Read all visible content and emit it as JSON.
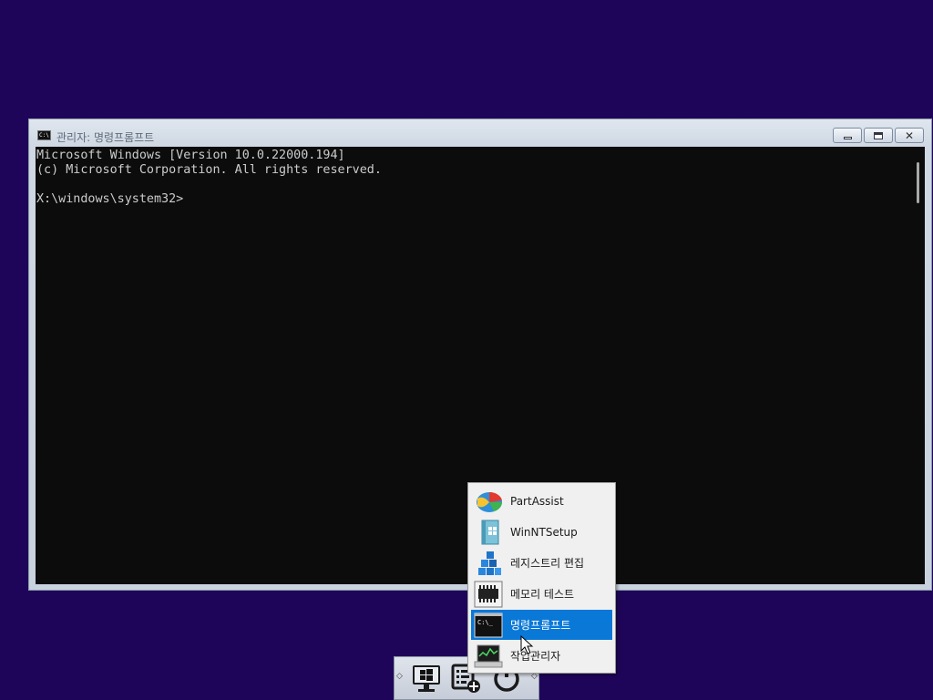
{
  "window": {
    "title": "관리자: 명령프롬프트",
    "icon_text": "C:\\"
  },
  "console": {
    "lines": [
      "Microsoft Windows [Version 10.0.22000.194]",
      "(c) Microsoft Corporation. All rights reserved.",
      "",
      "X:\\windows\\system32>"
    ]
  },
  "menu": {
    "items": [
      {
        "label": "PartAssist",
        "icon": "partassist-icon"
      },
      {
        "label": "WinNTSetup",
        "icon": "winntsetup-icon"
      },
      {
        "label": "레지스트리 편집",
        "icon": "registry-editor-icon"
      },
      {
        "label": "메모리 테스트",
        "icon": "memory-test-icon"
      },
      {
        "label": "명령프롬프트",
        "icon": "command-prompt-icon",
        "selected": true
      },
      {
        "label": "작업관리자",
        "icon": "task-manager-icon"
      }
    ],
    "cmd_icon_text": "C:\\_"
  },
  "taskbar": {
    "icons": [
      "pc-icon",
      "app-list-icon",
      "power-icon"
    ]
  },
  "colors": {
    "desktop": "#1e0559",
    "console_bg": "#0c0c0c",
    "console_text": "#cccccc",
    "menu_selected": "#0a78d7"
  }
}
